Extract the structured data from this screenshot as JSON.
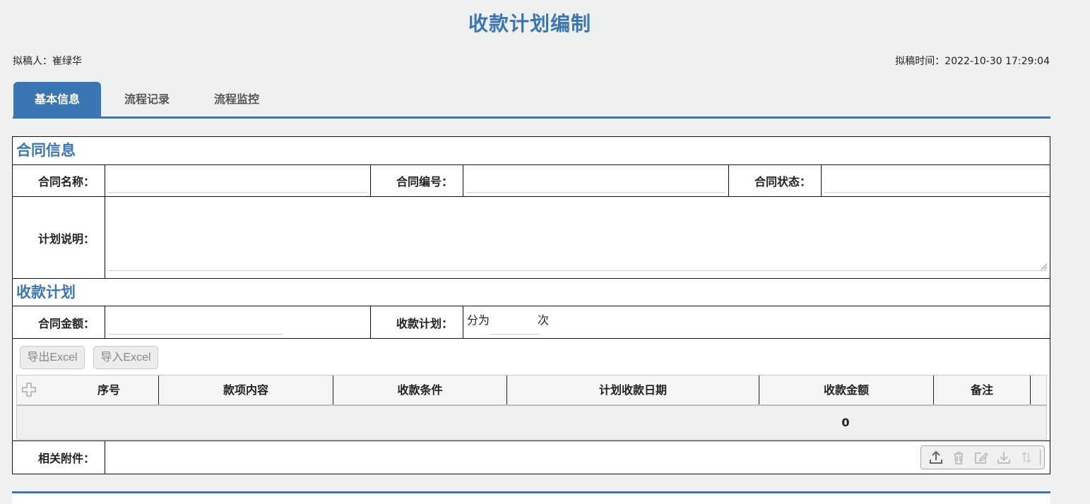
{
  "page": {
    "title": "收款计划编制",
    "drafter": "拟稿人：崔绿华",
    "draft_time": "拟稿时间：2022-10-30 17:29:04"
  },
  "tabs": [
    {
      "label": "基本信息",
      "active": true
    },
    {
      "label": "流程记录",
      "active": false
    },
    {
      "label": "流程监控",
      "active": false
    }
  ],
  "contract_section": {
    "title": "合同信息",
    "name_label": "合同名称：",
    "name_value": "",
    "number_label": "合同编号：",
    "number_value": "",
    "status_label": "合同状态：",
    "status_value": "",
    "plan_desc_label": "计划说明：",
    "plan_desc_value": ""
  },
  "payment_section": {
    "title": "收款计划",
    "amount_label": "合同金额：",
    "amount_value": "",
    "plan_label": "收款计划：",
    "split_prefix": "分为",
    "split_value": "",
    "split_suffix": "次",
    "export_button": "导出Excel",
    "import_button": "导入Excel",
    "columns": [
      "序号",
      "款项内容",
      "收款条件",
      "计划收款日期",
      "收款金额",
      "备注"
    ],
    "rows": [],
    "total_amount": "0"
  },
  "attachments": {
    "label": "相关附件：",
    "toolbar_icons": [
      "upload-icon",
      "delete-icon",
      "edit-icon",
      "download-icon",
      "sort-icon"
    ]
  },
  "colors": {
    "accent": "#3a75b4",
    "background": "#eff0f0"
  }
}
